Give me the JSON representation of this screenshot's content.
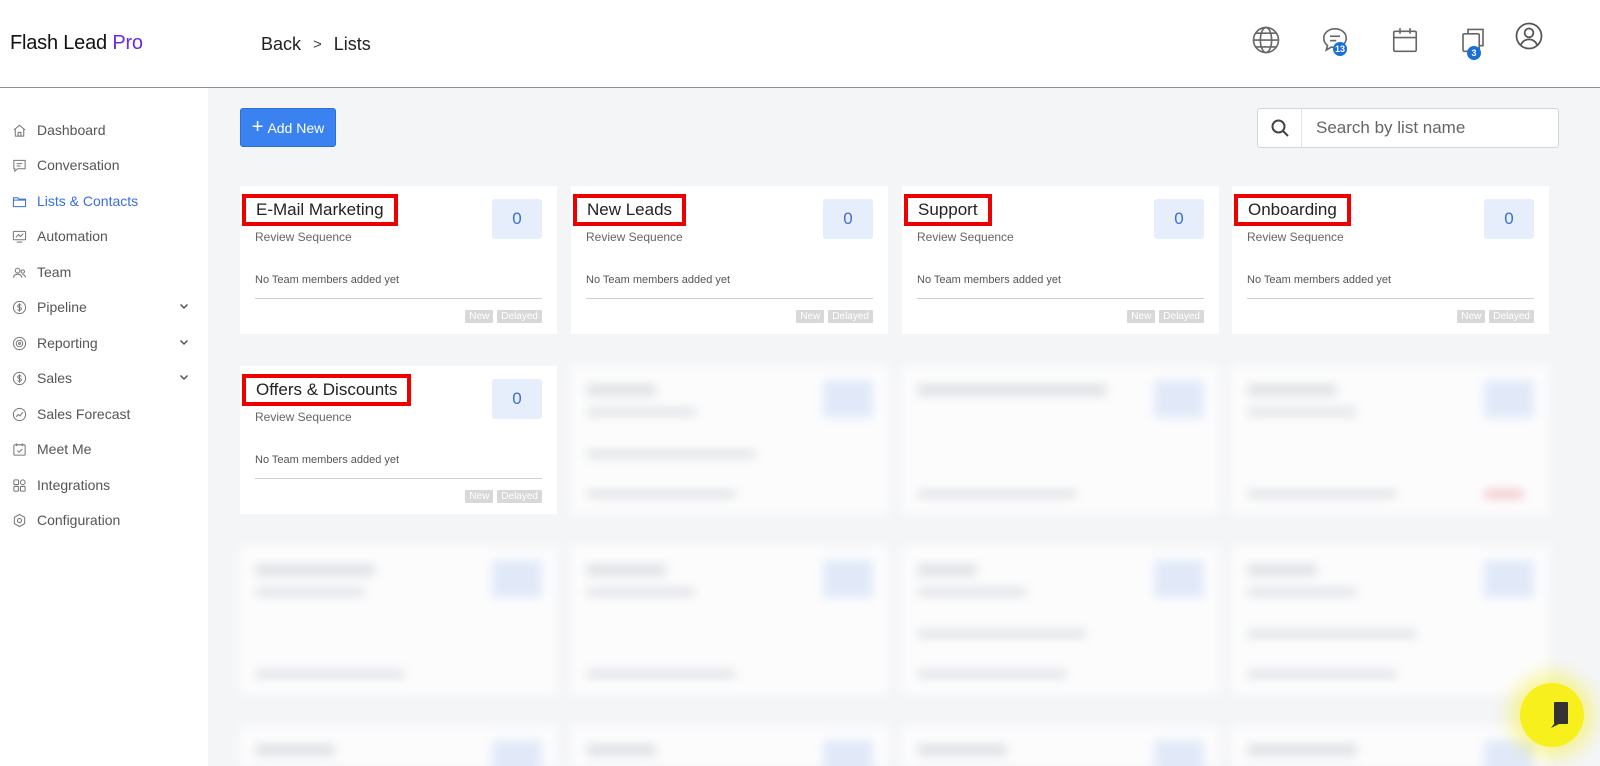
{
  "app": {
    "logo_main": "Flash Lead",
    "logo_accent": "Pro"
  },
  "breadcrumb": {
    "back": "Back",
    "separator": ">",
    "current": "Lists"
  },
  "header_icons": {
    "messages_badge": "13",
    "copies_badge": "3"
  },
  "sidebar": {
    "items": [
      {
        "label": "Dashboard",
        "icon": "home-icon"
      },
      {
        "label": "Conversation",
        "icon": "chat-icon"
      },
      {
        "label": "Lists & Contacts",
        "icon": "folder-icon",
        "active": true
      },
      {
        "label": "Automation",
        "icon": "automation-icon"
      },
      {
        "label": "Team",
        "icon": "team-icon"
      },
      {
        "label": "Pipeline",
        "icon": "dollar-icon",
        "expandable": true
      },
      {
        "label": "Reporting",
        "icon": "target-icon",
        "expandable": true
      },
      {
        "label": "Sales",
        "icon": "dollar-icon",
        "expandable": true
      },
      {
        "label": "Sales Forecast",
        "icon": "forecast-icon"
      },
      {
        "label": "Meet Me",
        "icon": "calendar-check-icon"
      },
      {
        "label": "Integrations",
        "icon": "integrations-icon"
      },
      {
        "label": "Configuration",
        "icon": "settings-icon"
      }
    ]
  },
  "toolbar": {
    "add_new_label": "Add New",
    "search_placeholder": "Search by list name"
  },
  "lists": [
    {
      "name": "E-Mail Marketing",
      "sequence": "Review Sequence",
      "count": "0",
      "team_note": "No Team members added yet",
      "tag_new": "New",
      "tag_delayed": "Delayed"
    },
    {
      "name": "New Leads",
      "sequence": "Review Sequence",
      "count": "0",
      "team_note": "No Team members added yet",
      "tag_new": "New",
      "tag_delayed": "Delayed"
    },
    {
      "name": "Support",
      "sequence": "Review Sequence",
      "count": "0",
      "team_note": "No Team members added yet",
      "tag_new": "New",
      "tag_delayed": "Delayed"
    },
    {
      "name": "Onboarding",
      "sequence": "Review Sequence",
      "count": "0",
      "team_note": "No Team members added yet",
      "tag_new": "New",
      "tag_delayed": "Delayed"
    },
    {
      "name": "Offers & Discounts",
      "sequence": "Review Sequence",
      "count": "0",
      "team_note": "No Team members added yet",
      "tag_new": "New",
      "tag_delayed": "Delayed"
    }
  ],
  "colors": {
    "accent": "#6a2be6",
    "primary_button": "#3a82f0",
    "active_nav": "#3a6ed8",
    "highlight_border": "#ee0000",
    "help_bubble": "#f7f01c"
  }
}
